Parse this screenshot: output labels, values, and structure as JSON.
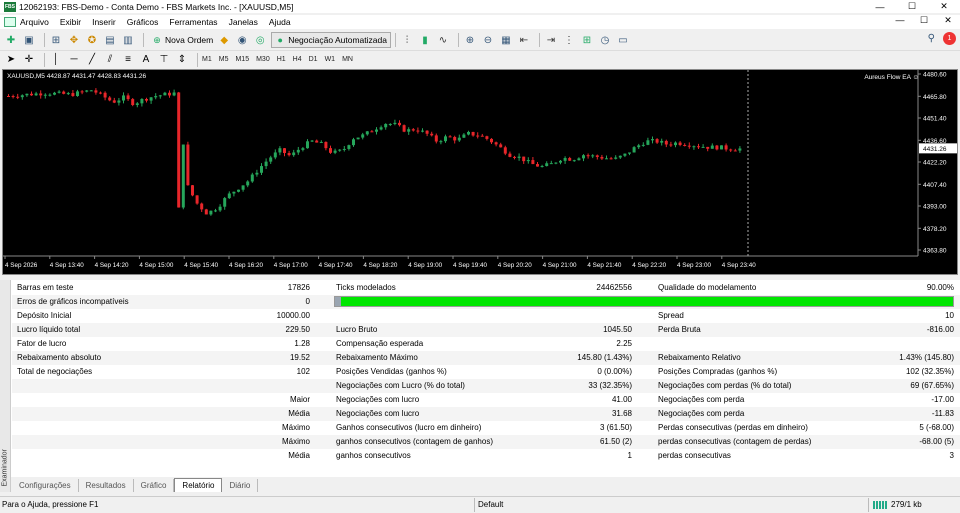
{
  "window": {
    "title": "12062193: FBS-Demo - Conta Demo - FBS Markets Inc. - [XAUUSD,M5]",
    "logo": "FBS",
    "controls": [
      "—",
      "☐",
      "✕"
    ]
  },
  "menu": {
    "items": [
      "Arquivo",
      "Exibir",
      "Inserir",
      "Gráficos",
      "Ferramentas",
      "Janelas",
      "Ajuda"
    ],
    "right_controls": [
      "—",
      "☐",
      "✕"
    ]
  },
  "toolbar": {
    "new_order": "Nova Ordem",
    "auto_trading": "Negociação Automatizada",
    "notification_count": "1"
  },
  "timeframes": [
    "M1",
    "M5",
    "M15",
    "M30",
    "H1",
    "H4",
    "D1",
    "W1",
    "MN"
  ],
  "chart": {
    "symbol_info": "XAUUSD,M5  4428.87 4431.47 4428.83 4431.26",
    "ea_name": "Aureus Flow EA ☺",
    "current_price": "4431.26",
    "price_labels": [
      "4480.60",
      "4465.80",
      "4451.40",
      "4436.60",
      "4422.20",
      "4407.40",
      "4393.00",
      "4378.20",
      "4363.80"
    ],
    "time_labels": [
      "4 Sep 2026",
      "4 Sep 13:40",
      "4 Sep 14:20",
      "4 Sep 15:00",
      "4 Sep 15:40",
      "4 Sep 16:20",
      "4 Sep 17:00",
      "4 Sep 17:40",
      "4 Sep 18:20",
      "4 Sep 19:00",
      "4 Sep 19:40",
      "4 Sep 20:20",
      "4 Sep 21:00",
      "4 Sep 21:40",
      "4 Sep 22:20",
      "4 Sep 23:00",
      "4 Sep 23:40"
    ],
    "colors": {
      "bull": "#26a65b",
      "bear": "#e8262a",
      "background": "#000000"
    }
  },
  "report": {
    "rows": [
      {
        "c1": "Barras em teste",
        "v1": "17826",
        "c2": "Ticks modelados",
        "v2": "24462556",
        "c3": "Qualidade do modelamento",
        "v3": "90.00%"
      },
      {
        "c1": "Erros de gráficos incompatíveis",
        "v1": "0",
        "c2": "",
        "v2": "",
        "c3": "",
        "v3": ""
      },
      {
        "c1": "Depósito Inicial",
        "v1": "10000.00",
        "c2": "",
        "v2": "",
        "c3": "Spread",
        "v3": "10"
      },
      {
        "c1": "Lucro líquido total",
        "v1": "229.50",
        "c2": "Lucro Bruto",
        "v2": "1045.50",
        "c3": "Perda Bruta",
        "v3": "-816.00"
      },
      {
        "c1": "Fator de lucro",
        "v1": "1.28",
        "c2": "Compensação esperada",
        "v2": "2.25",
        "c3": "",
        "v3": ""
      },
      {
        "c1": "Rebaixamento absoluto",
        "v1": "19.52",
        "c2": "Rebaixamento Máximo",
        "v2": "145.80 (1.43%)",
        "c3": "Rebaixamento Relativo",
        "v3": "1.43% (145.80)"
      },
      {
        "c1": "Total de negociações",
        "v1": "102",
        "c2": "Posições Vendidas (ganhos %)",
        "v2": "0 (0.00%)",
        "c3": "Posições Compradas (ganhos %)",
        "v3": "102 (32.35%)"
      },
      {
        "c1": "",
        "v1": "",
        "c2": "Negociações com Lucro (% do total)",
        "v2": "33 (32.35%)",
        "c3": "Negociações com perdas (% do total)",
        "v3": "69 (67.65%)"
      },
      {
        "c1": "",
        "v1": "Maior",
        "c2": "Negociações com lucro",
        "v2": "41.00",
        "c3": "Negociações com perda",
        "v3": "-17.00"
      },
      {
        "c1": "",
        "v1": "Média",
        "c2": "Negociações com lucro",
        "v2": "31.68",
        "c3": "Negociações com perda",
        "v3": "-11.83"
      },
      {
        "c1": "",
        "v1": "Máximo",
        "c2": "Ganhos consecutivos (lucro em dinheiro)",
        "v2": "3 (61.50)",
        "c3": "Perdas consecutivas (perdas em dinheiro)",
        "v3": "5 (-68.00)"
      },
      {
        "c1": "",
        "v1": "Máximo",
        "c2": "ganhos consecutivos (contagem de ganhos)",
        "v2": "61.50 (2)",
        "c3": "perdas consecutivas (contagem de perdas)",
        "v3": "-68.00 (5)"
      },
      {
        "c1": "",
        "v1": "Média",
        "c2": "ganhos consecutivos",
        "v2": "1",
        "c3": "perdas consecutivas",
        "v3": "3"
      }
    ],
    "modelling_quality_fraction": 0.9
  },
  "side_panel": "Examinador",
  "tabs": [
    "Configurações",
    "Resultados",
    "Gráfico",
    "Relatório",
    "Diário"
  ],
  "active_tab": "Relatório",
  "status": {
    "help": "Para o Ajuda, pressione F1",
    "profile": "Default",
    "traffic": "279/1 kb"
  }
}
